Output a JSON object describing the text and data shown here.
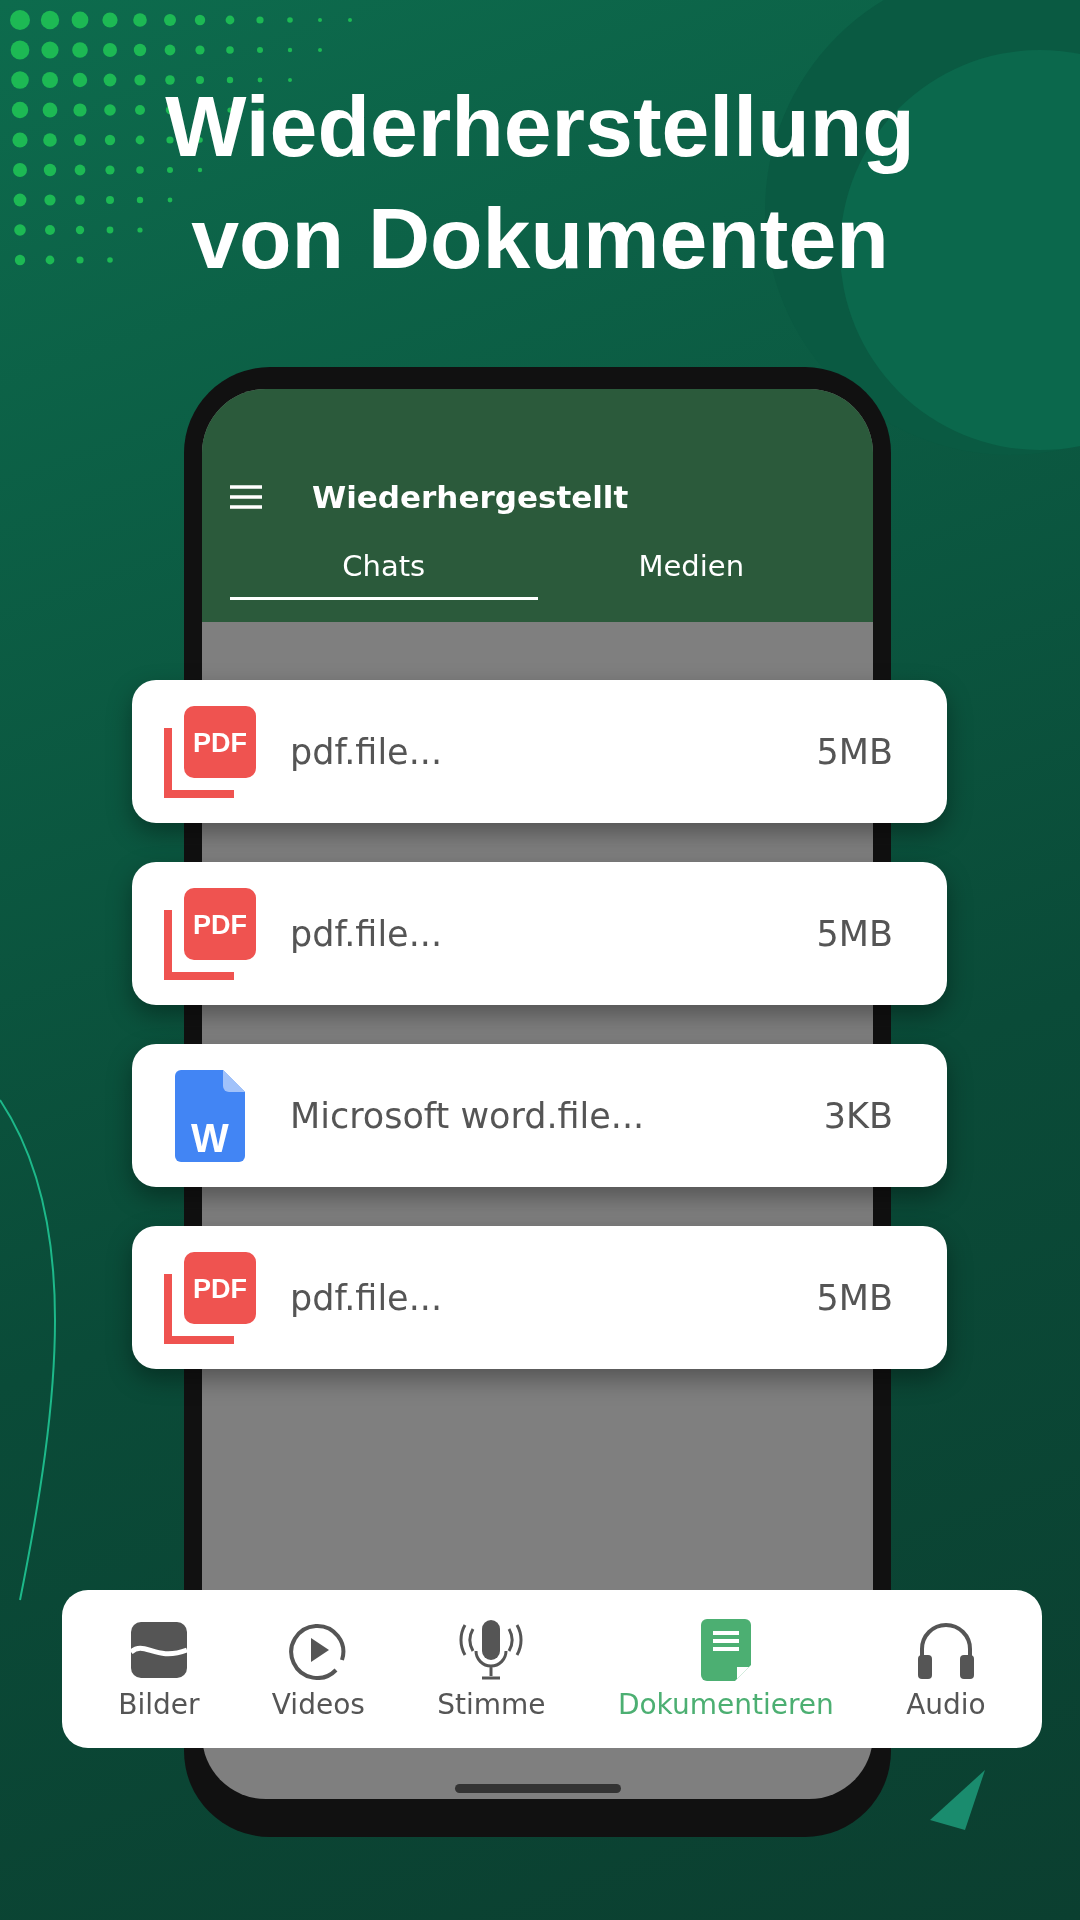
{
  "headline": [
    "Wiederherstellung",
    "von Dokumenten"
  ],
  "app_bar": {
    "title": "Wiederhergestellt"
  },
  "tabs": [
    {
      "label": "Chats",
      "selected": true
    },
    {
      "label": "Medien",
      "selected": false
    }
  ],
  "files": [
    {
      "kind": "pdf",
      "badge": "PDF",
      "name": "pdf.file...",
      "size": "5MB"
    },
    {
      "kind": "pdf",
      "badge": "PDF",
      "name": "pdf.file...",
      "size": "5MB"
    },
    {
      "kind": "word",
      "badge": "W",
      "name": "Microsoft word.file...",
      "size": "3KB"
    },
    {
      "kind": "pdf",
      "badge": "PDF",
      "name": "pdf.file...",
      "size": "5MB"
    }
  ],
  "bottom_nav": [
    {
      "kind": "images",
      "label": "Bilder",
      "selected": false
    },
    {
      "kind": "videos",
      "label": "Videos",
      "selected": false
    },
    {
      "kind": "voice",
      "label": "Stimme",
      "selected": false
    },
    {
      "kind": "documents",
      "label": "Dokumentieren",
      "selected": true
    },
    {
      "kind": "audio",
      "label": "Audio",
      "selected": false
    }
  ]
}
